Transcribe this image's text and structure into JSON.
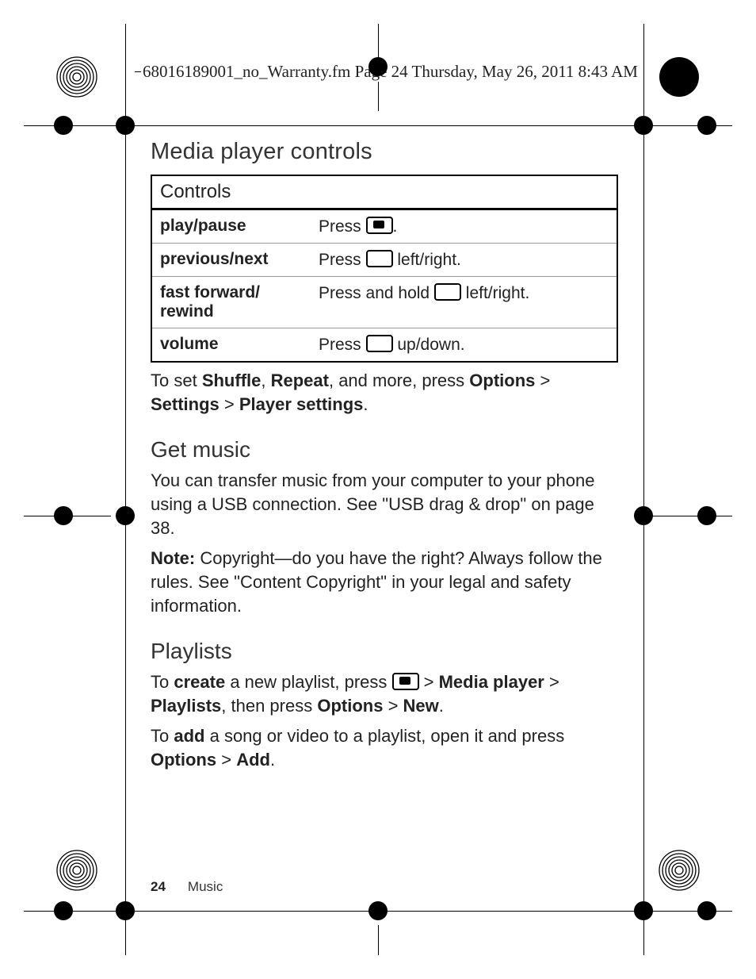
{
  "header": {
    "text": "68016189001_no_Warranty.fm  Page 24  Thursday, May 26, 2011  8:43 AM"
  },
  "headings": {
    "media_player_controls": "Media player controls",
    "get_music": "Get music",
    "playlists": "Playlists"
  },
  "table": {
    "title": "Controls",
    "rows": [
      {
        "label": "play/pause",
        "before": "Press ",
        "icon": "center",
        "after": "."
      },
      {
        "label": "previous/next",
        "before": "Press ",
        "icon": "nav",
        "after": " left/right."
      },
      {
        "label": "fast forward/ rewind",
        "before": "Press and hold ",
        "icon": "nav",
        "after": " left/right."
      },
      {
        "label": "volume",
        "before": "Press ",
        "icon": "nav",
        "after": " up/down."
      }
    ]
  },
  "shuffle_para": {
    "t1": "To set ",
    "b1": "Shuffle",
    "t2": ", ",
    "b2": "Repeat",
    "t3": ", and more, press ",
    "b3": "Options",
    "t4": " > ",
    "b4": "Settings",
    "t5": " > ",
    "b5": "Player settings",
    "t6": "."
  },
  "get_music_para": "You can transfer music from your computer to your phone using a USB connection. See \"USB drag & drop\" on page 38.",
  "note_para": {
    "label": "Note:",
    "text": " Copyright—do you have the right? Always follow the rules. See \"Content Copyright\" in your legal and safety information."
  },
  "playlists_create": {
    "t1": "To ",
    "b1": "create",
    "t2": " a new playlist, press ",
    "t3": " > ",
    "b2": "Media player",
    "t4": " > ",
    "b3": "Playlists",
    "t5": ", then press ",
    "b4": "Options",
    "t6": " > ",
    "b5": "New",
    "t7": "."
  },
  "playlists_add": {
    "t1": "To ",
    "b1": "add",
    "t2": " a song or video to a playlist, open it and press ",
    "b2": "Options",
    "t3": " > ",
    "b3": "Add",
    "t4": "."
  },
  "footer": {
    "page": "24",
    "chapter": "Music"
  }
}
